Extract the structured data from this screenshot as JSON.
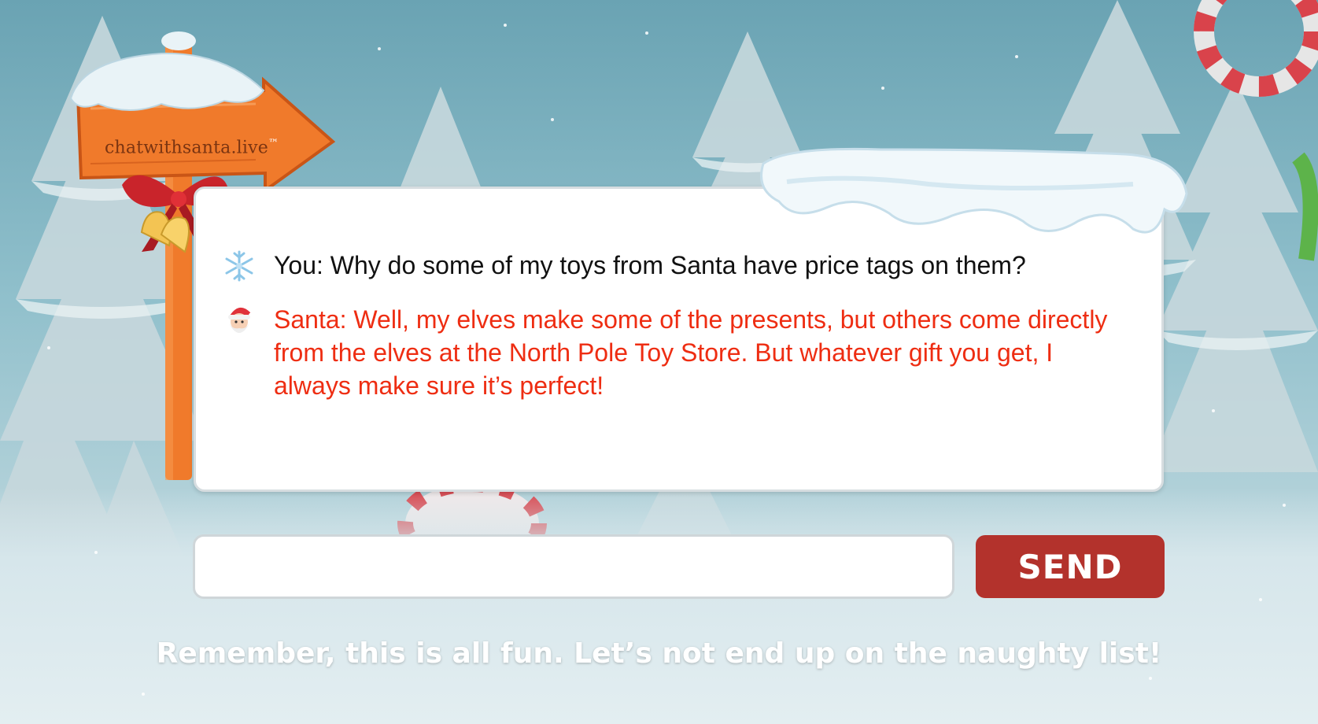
{
  "brand": {
    "sign_text": "chatwithsanta.live",
    "trademark": "™"
  },
  "chat": {
    "messages": [
      {
        "sender": "user",
        "icon": "snowflake-icon",
        "text": "You: Why do some of my toys from Santa have price tags on them?"
      },
      {
        "sender": "santa",
        "icon": "santa-icon",
        "text": "Santa: Well, my elves make some of the presents, but others come directly from the elves at the North Pole Toy Store. But whatever gift you get, I always make sure it’s perfect!"
      }
    ]
  },
  "composer": {
    "input_value": "",
    "send_label": "SEND"
  },
  "footer": {
    "disclaimer": "Remember, this is all fun. Let’s not end up on the naughty list!"
  },
  "colors": {
    "santa_text": "#ee2d12",
    "user_text": "#111111",
    "send_button": "#b3322c",
    "sign_wood": "#f07a2b"
  }
}
